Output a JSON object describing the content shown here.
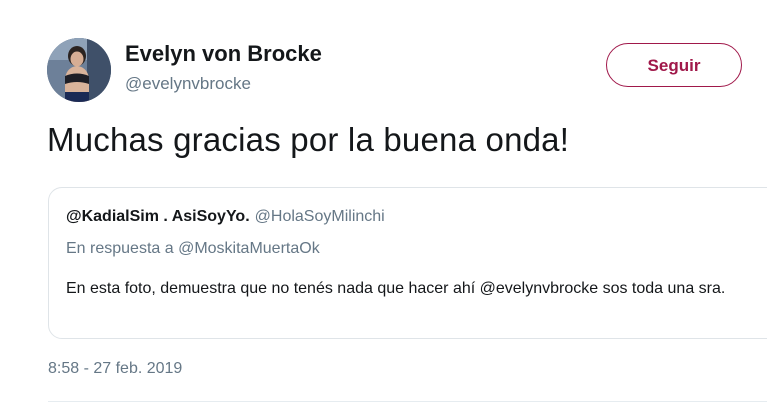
{
  "author": {
    "display_name": "Evelyn von Brocke",
    "handle": "@evelynvbrocke",
    "avatar_icon": "profile-photo"
  },
  "follow_button": {
    "label": "Seguir",
    "color": "#a0184a"
  },
  "tweet": {
    "text": "Muchas gracias por la buena onda!",
    "timestamp": "8:58 - 27 feb. 2019"
  },
  "quoted_tweet": {
    "author_name": "@KadialSim . AsiSoyYo.",
    "author_handle": "@HolaSoyMilinchi",
    "reply_prefix": "En respuesta a",
    "reply_to_handle": "@MoskitaMuertaOk",
    "text": "En esta foto, demuestra que no tenés nada que hacer ahí @evelynvbrocke sos toda una sra."
  },
  "colors": {
    "text_primary": "#14171a",
    "text_secondary": "#657786",
    "border": "#dfe4e8"
  }
}
